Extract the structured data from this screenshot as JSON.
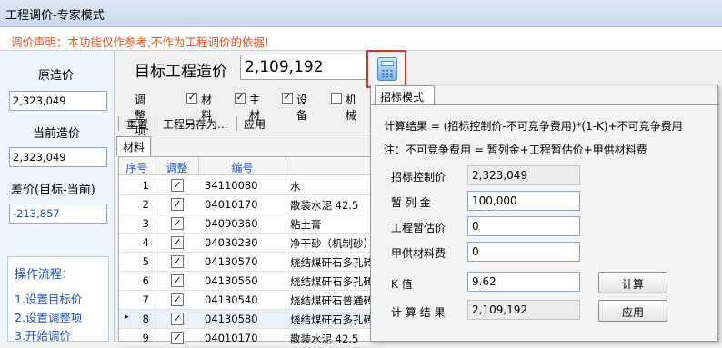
{
  "window": {
    "title": "工程调价-专家模式"
  },
  "notice": "调价声明：本功能仅作参考,不作为工程调价的依据!",
  "left_panel": {
    "original_label": "原造价",
    "original_value": "2,323,049",
    "current_label": "当前造价",
    "current_value": "2,323,049",
    "diff_label": "差价(目标-当前)",
    "diff_value": "-213,857",
    "flow_title": "操作流程：",
    "flow_steps": [
      "1.设置目标价",
      "2.设置调整项",
      "3.开始调价"
    ]
  },
  "target": {
    "label": "目标工程造价",
    "value": "2,109,192"
  },
  "adjust": {
    "label": "调整项:",
    "items": [
      {
        "label": "材料",
        "checked": true
      },
      {
        "label": "主材",
        "checked": true
      },
      {
        "label": "设备",
        "checked": true
      },
      {
        "label": "机械",
        "checked": false
      }
    ]
  },
  "toolbar": {
    "reset": "重置",
    "save_as": "工程另存为...",
    "apply": "应用"
  },
  "tabs": {
    "materials": "材料"
  },
  "table": {
    "headers": [
      "序号",
      "调整",
      "编号"
    ],
    "rows": [
      {
        "no": "1",
        "checked": true,
        "code": "34110080",
        "name": "水",
        "current": false
      },
      {
        "no": "2",
        "checked": true,
        "code": "04010170",
        "name": "散装水泥 42.5",
        "current": false
      },
      {
        "no": "3",
        "checked": true,
        "code": "04090360",
        "name": "粘土膏",
        "current": false
      },
      {
        "no": "4",
        "checked": true,
        "code": "04030230",
        "name": "净干砂（机制砂）",
        "current": false
      },
      {
        "no": "5",
        "checked": true,
        "code": "04130570",
        "name": "烧结煤矸石多孔砖",
        "current": false
      },
      {
        "no": "6",
        "checked": true,
        "code": "04130560",
        "name": "烧结煤矸石多孔砖",
        "current": false
      },
      {
        "no": "7",
        "checked": true,
        "code": "04130540",
        "name": "烧结煤矸石普通砖",
        "current": false
      },
      {
        "no": "8",
        "checked": true,
        "code": "04130580",
        "name": "烧结煤矸石多孔砖",
        "current": true
      },
      {
        "no": "9",
        "checked": true,
        "code": "04010170",
        "name": "散装水泥 42.5",
        "current": false
      }
    ]
  },
  "popup": {
    "tab": "招标模式",
    "formula": "计算结果 = (招标控制价-不可竞争费用)*(1-K)+不可竞争费用",
    "note": "注：不可竞争费用 = 暂列金+工程暂估价+甲供材料费",
    "fields": [
      {
        "label": "招标控制价",
        "value": "2,323,049",
        "readonly": true
      },
      {
        "label": "暂 列 金",
        "value": "100,000",
        "readonly": false
      },
      {
        "label": "工程暂估价",
        "value": "0",
        "readonly": false
      },
      {
        "label": "甲供材料费",
        "value": "0",
        "readonly": false
      },
      {
        "label": "K 值",
        "value": "9.62",
        "readonly": false
      },
      {
        "label": "计 算 结 果",
        "value": "2,109,192",
        "readonly": true
      }
    ],
    "calc_button": "计算",
    "apply_button": "应用"
  }
}
